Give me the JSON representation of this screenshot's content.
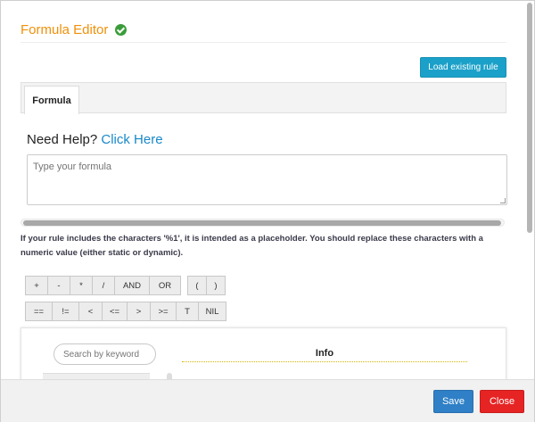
{
  "header": {
    "title": "Formula Editor",
    "status_icon": "check-circle-icon",
    "status_color": "#3a9d3a"
  },
  "toolbar": {
    "load_label": "Load existing rule"
  },
  "tabs": [
    {
      "label": "Formula",
      "active": true
    }
  ],
  "help": {
    "prefix": "Need Help?",
    "link": "Click Here"
  },
  "formula": {
    "placeholder": "Type your formula",
    "value": ""
  },
  "note": "If your rule includes the characters '%1', it is intended as a placeholder. You should replace these characters with a numeric value (either static or dynamic).",
  "operators": {
    "row1": [
      "+",
      "-",
      "*",
      "/",
      "AND",
      "OR",
      "(",
      ")"
    ],
    "row2": [
      "==",
      "!=",
      "<",
      "<=",
      ">",
      ">=",
      "T",
      "NIL"
    ]
  },
  "panel": {
    "search_placeholder": "Search by keyword",
    "info_title": "Info"
  },
  "footer": {
    "save_label": "Save",
    "close_label": "Close"
  },
  "colors": {
    "accent": "#f0900a",
    "primary": "#2f80c6",
    "info_button": "#1ba1c9",
    "danger": "#e62424",
    "link": "#1a88c9"
  }
}
